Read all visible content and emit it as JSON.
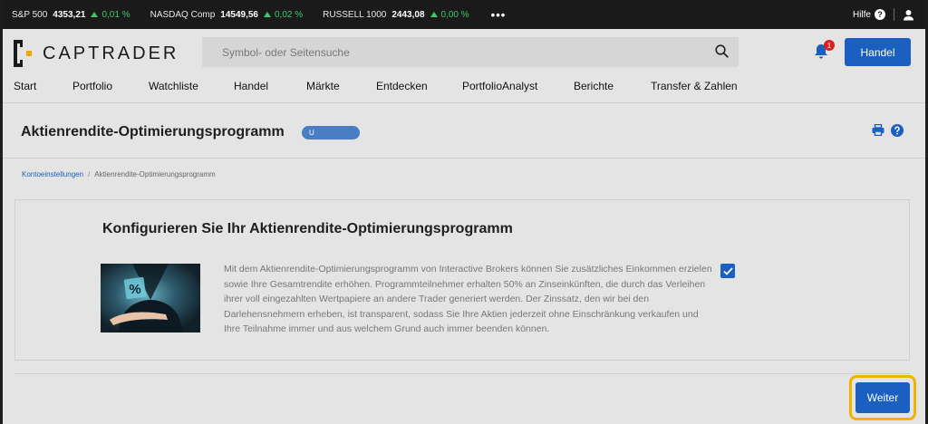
{
  "ticker": {
    "items": [
      {
        "name": "S&P 500",
        "value": "4353,21",
        "change": "0,01 %"
      },
      {
        "name": "NASDAQ Comp",
        "value": "14549,56",
        "change": "0,02 %"
      },
      {
        "name": "RUSSELL 1000",
        "value": "2443,08",
        "change": "0,00 %"
      }
    ],
    "more": "•••",
    "help_label": "Hilfe",
    "help_q": "?"
  },
  "header": {
    "logo_text": "CAPTRADER",
    "search_placeholder": "Symbol- oder Seitensuche",
    "notification_count": "1",
    "trade_button": "Handel"
  },
  "nav": {
    "items": [
      "Start",
      "Portfolio",
      "Watchliste",
      "Handel",
      "Märkte",
      "Entdecken",
      "PortfolioAnalyst",
      "Berichte",
      "Transfer & Zahlen"
    ]
  },
  "page": {
    "title": "Aktienrendite-Optimierungsprogramm",
    "pill": "U"
  },
  "breadcrumb": {
    "parent": "Kontoeinstellungen",
    "separator": "/",
    "current": "Aktienrendite-Optimierungsprogramm"
  },
  "card": {
    "title": "Konfigurieren Sie Ihr Aktienrendite-Optimierungsprogramm",
    "description": "Mit dem Aktienrendite-Optimierungsprogramm von Interactive Brokers können Sie zusätzliches Einkommen erzielen sowie Ihre Gesamtrendite erhöhen. Programmteilnehmer erhalten 50% an Zinseinkünften, die durch das Verleihen ihrer voll eingezahlten Wertpapiere an andere Trader generiert werden. Der Zinssatz, den wir bei den Darlehensnehmern erheben, ist transparent, sodass Sie Ihre Aktien jederzeit ohne Einschränkung verkaufen und Ihre Teilnahme immer und aus welchem Grund auch immer beenden können.",
    "thumb_symbol": "%",
    "checked": true
  },
  "footer": {
    "continue_button": "Weiter"
  },
  "colors": {
    "accent": "#1b5fc1",
    "positive": "#3cc96a",
    "highlight": "#f0b400",
    "badge": "#d8201f"
  }
}
